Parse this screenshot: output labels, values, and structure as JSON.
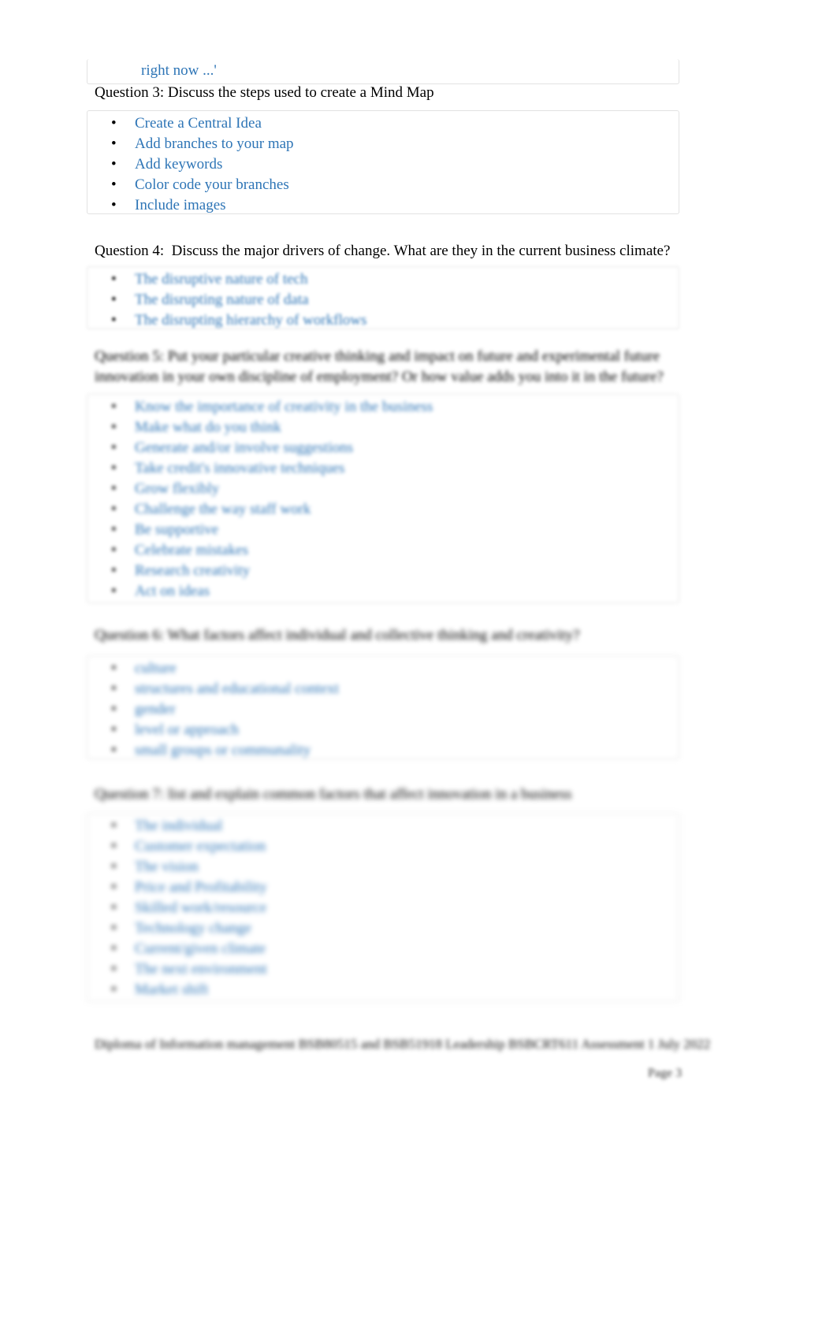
{
  "document": {
    "top_fragment": {
      "text": "right now ...'"
    },
    "questions": [
      {
        "id": "q3",
        "heading": "Question 3: Discuss the steps used to create a Mind Map",
        "answers": [
          "Create a Central Idea",
          "Add branches to your map",
          "Add keywords",
          "Color code your branches",
          "Include images"
        ]
      },
      {
        "id": "q4",
        "heading": "Question 4:  Discuss the major drivers of change. What are they in the current business climate?",
        "answers": [
          "The disruptive nature of tech",
          "The disrupting nature of data",
          "The disrupting hierarchy of workflows"
        ]
      },
      {
        "id": "q5",
        "heading": "Question 5: Put your particular creative thinking and impact on future and experimental future innovation in your own discipline of employment? Or how value adds you into it in the future?",
        "answers": [
          "Know the importance of creativity in the business",
          "Make what do you think",
          "Generate and/or involve suggestions",
          "Take credit's innovative techniques",
          "Grow flexibly",
          "Challenge the way staff work",
          "Be supportive",
          "Celebrate mistakes",
          "Research creativity",
          "Act on ideas"
        ]
      },
      {
        "id": "q6",
        "heading": "Question 6: What factors affect individual and collective thinking and creativity?",
        "answers": [
          "culture",
          "structures and educational context",
          "gender",
          "level or approach",
          "small groups or communality"
        ]
      },
      {
        "id": "q7",
        "heading": "Question 7: list and explain common factors that affect innovation in a business",
        "answers": [
          "The individual",
          "Customer expectation",
          "The vision",
          "Price and Profitability",
          "Skilled work/resource",
          "Technology change",
          "Current/given climate",
          "The next environment",
          "Market shift"
        ]
      }
    ],
    "footer": {
      "text": "Diploma of Information management BSB80515 and BSB51918 Leadership BSBCRT611 Assessment 1 July 2022",
      "page_number": "Page 3"
    }
  },
  "colors": {
    "answer_text": "#2e75b6",
    "body_text": "#000000",
    "box_border": "#e2e2e2",
    "page_background": "#ffffff"
  }
}
